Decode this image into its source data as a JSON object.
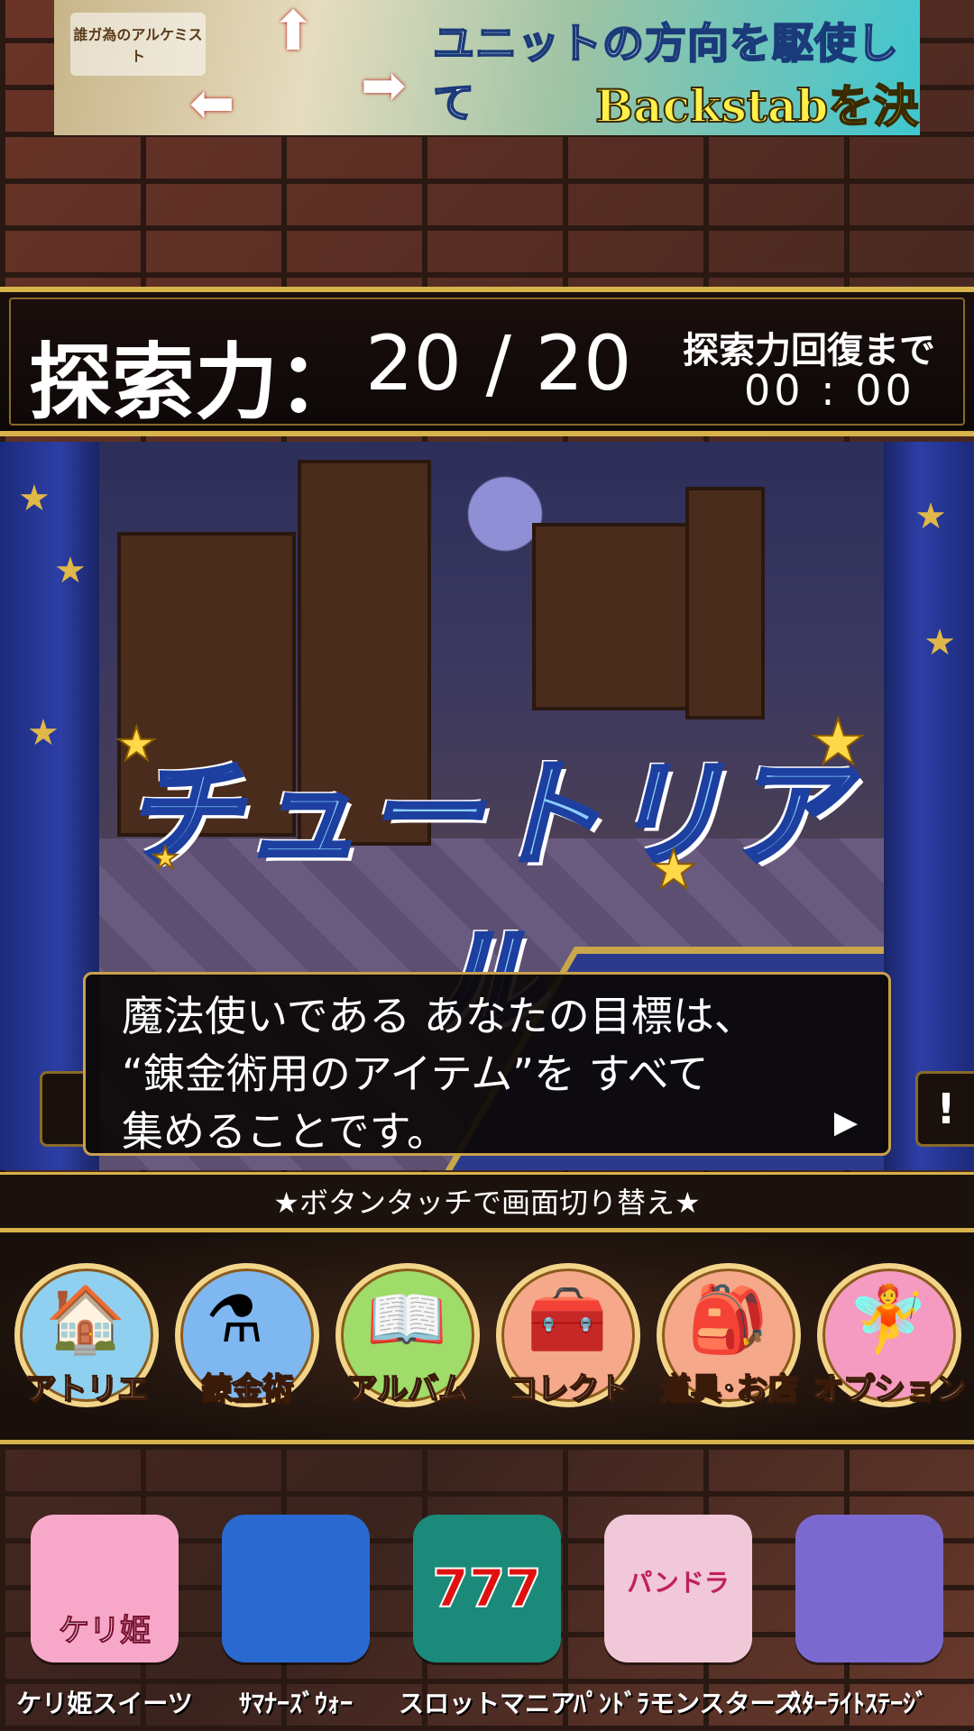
{
  "banner": {
    "logo_text": "誰ガ為のアルケミスト",
    "headline": "ユニットの方向を駆使して",
    "subline": "Backstabを決めろ"
  },
  "stamina": {
    "label": "探索力：",
    "value": "20 / 20",
    "recover_label": "探索力回復まで",
    "recover_time": "00 : 00"
  },
  "tutorial": {
    "title": "チュートリアル",
    "dialog_lines": [
      "魔法使いである あなたの目標は、",
      "“錬金術用のアイテム”を すべて",
      "集めることです。"
    ],
    "next_glyph": "▶",
    "side_glyph": "!"
  },
  "hint": "★ボタンタッチで画面切り替え★",
  "menu": [
    {
      "label": "アトリエ",
      "icon": "house-icon",
      "color": "#8fd0f0"
    },
    {
      "label": "錬金術",
      "icon": "potion-icon",
      "color": "#7fb8f0"
    },
    {
      "label": "アルバム",
      "icon": "book-icon",
      "color": "#9fdc6a"
    },
    {
      "label": "コレクト",
      "icon": "chest-icon",
      "color": "#f5a98a"
    },
    {
      "label": "道具･お店",
      "icon": "bag-icon",
      "color": "#f5a88a"
    },
    {
      "label": "オプション",
      "icon": "character-icon",
      "color": "#f59ac0"
    }
  ],
  "apps": [
    {
      "name": "ケリ姫スイーツ",
      "icon_text": "ケリ姫",
      "color": "#f7a8c8"
    },
    {
      "name": "ｻﾏﾅｰｽﾞｳｫｰ",
      "icon_text": "",
      "color": "#2a6ad0"
    },
    {
      "name": "スロットマニア",
      "icon_text": "777",
      "color": "#1b8a7a"
    },
    {
      "name": "ﾊﾟﾝﾄﾞﾗモンスターズ",
      "icon_text": "パンドラ",
      "color": "#f0c8d8"
    },
    {
      "name": "ｽﾀｰﾗｲﾄｽﾃｰｼﾞ",
      "icon_text": "",
      "color": "#7a6ad0"
    }
  ]
}
